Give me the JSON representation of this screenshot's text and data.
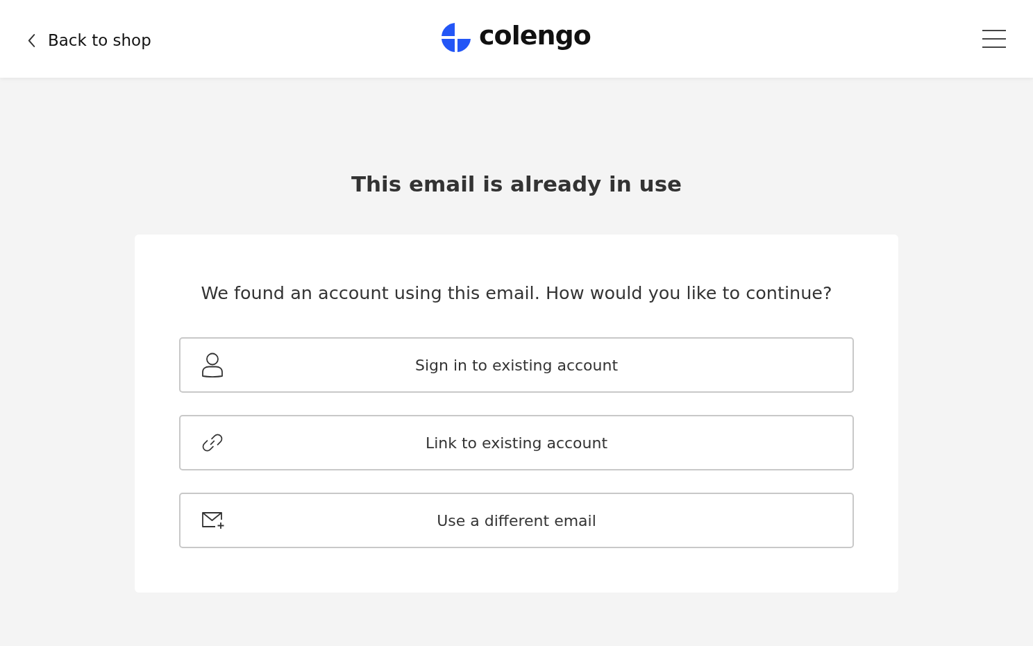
{
  "header": {
    "back_link": "Back to shop",
    "logo_text": "colengo"
  },
  "title": "This email is already in use",
  "card": {
    "prompt": "We found an account using this email. How would you like to continue?",
    "options": [
      {
        "kind": "user",
        "label": "Sign in to existing account"
      },
      {
        "kind": "link",
        "label": "Link to existing account"
      },
      {
        "kind": "email",
        "label": "Use a different email"
      }
    ]
  }
}
